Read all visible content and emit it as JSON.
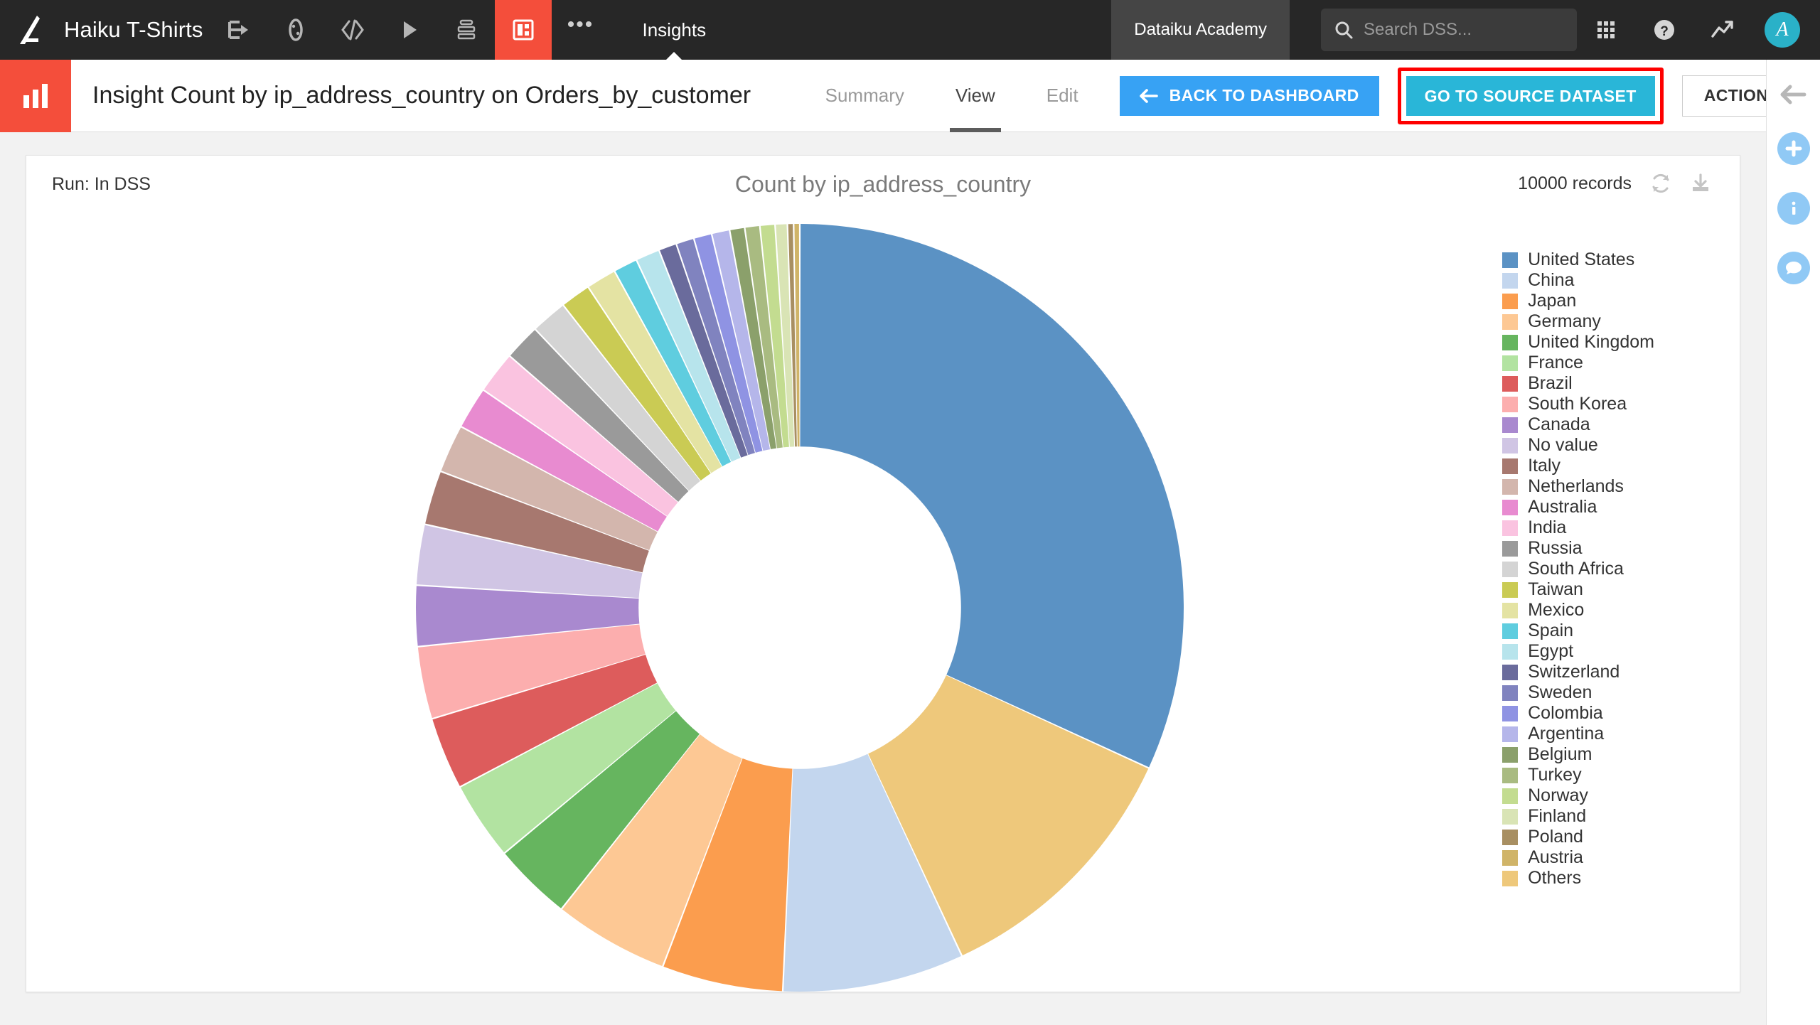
{
  "topbar": {
    "logo_icon": "dataiku-logo-icon",
    "project_name": "Haiku T-Shirts",
    "nav_icons": [
      {
        "name": "flow-icon",
        "label": "Flow"
      },
      {
        "name": "lab-icon",
        "label": "Lab"
      },
      {
        "name": "code-icon",
        "label": "Code"
      },
      {
        "name": "automation-icon",
        "label": "Automation"
      },
      {
        "name": "jobs-icon",
        "label": "Jobs"
      },
      {
        "name": "dashboards-icon",
        "label": "Dashboards"
      }
    ],
    "more_label": "•••",
    "current_section": "Insights",
    "academy_label": "Dataiku Academy",
    "search_placeholder": "Search DSS...",
    "search_value": "",
    "apps_icon": "apps-grid-icon",
    "help_icon": "help-circle-icon",
    "activity_icon": "trending-up-icon",
    "avatar_initial": "A",
    "accent_red": "#f44e3b",
    "avatar_color": "#2ab1c8"
  },
  "subbar": {
    "insight_icon": "bar-chart-icon",
    "title": "Insight Count by ip_address_country on Orders_by_customer",
    "tabs": [
      {
        "label": "Summary",
        "active": false
      },
      {
        "label": "View",
        "active": true
      },
      {
        "label": "Edit",
        "active": false
      }
    ],
    "back_to_dashboard_label": "BACK TO DASHBOARD",
    "back_arrow_icon": "arrow-left-icon",
    "go_to_source_label": "GO TO SOURCE DATASET",
    "actions_label": "ACTIONS",
    "highlight_color": "#fe0000",
    "primary_button_color": "#37a2f4",
    "source_button_color": "#29b6d8"
  },
  "right_rail": {
    "items": [
      {
        "name": "collapse-panel-icon",
        "glyph": "arrow-left"
      },
      {
        "name": "add-icon",
        "glyph": "plus"
      },
      {
        "name": "info-icon",
        "glyph": "info"
      },
      {
        "name": "discussions-icon",
        "glyph": "chat"
      }
    ],
    "circle_color": "#90c9f5"
  },
  "card": {
    "run_label": "Run: In DSS",
    "records_label": "10000 records",
    "refresh_icon": "refresh-icon",
    "download_icon": "download-icon"
  },
  "chart_data": {
    "type": "pie",
    "variant": "donut",
    "title": "Count by ip_address_country",
    "xlabel": "",
    "ylabel": "",
    "total_records": 10000,
    "legend_position": "right",
    "start_angle_deg": 0,
    "inner_radius_ratio": 0.42,
    "categories": [
      "United States",
      "China",
      "Japan",
      "Germany",
      "United Kingdom",
      "France",
      "Brazil",
      "South Korea",
      "Canada",
      "No value",
      "Italy",
      "Netherlands",
      "Australia",
      "India",
      "Russia",
      "South Africa",
      "Taiwan",
      "Mexico",
      "Spain",
      "Egypt",
      "Switzerland",
      "Sweden",
      "Colombia",
      "Argentina",
      "Belgium",
      "Turkey",
      "Norway",
      "Finland",
      "Poland",
      "Austria",
      "Others"
    ],
    "values": [
      3472,
      833,
      556,
      528,
      361,
      361,
      333,
      333,
      278,
      278,
      250,
      222,
      194,
      194,
      167,
      167,
      139,
      139,
      111,
      111,
      83,
      83,
      83,
      83,
      69,
      69,
      69,
      56,
      28,
      28,
      1222
    ],
    "colors": [
      "#5c93c6",
      "#c5d7ef",
      "#fc9e4f",
      "#fdc894",
      "#65b濃"
    ],
    "slice_colors": [
      "#5b92c4",
      "#c3d6ee",
      "#fb9d4e",
      "#fdc894",
      "#66b55f",
      "#b2e3a1",
      "#dd5c5c",
      "#fcaeae",
      "#a989cf",
      "#d0c5e4",
      "#a7786f",
      "#d3b6ad",
      "#e88bd0",
      "#fac3e0",
      "#9a9a9a",
      "#d4d4d4",
      "#cacb54",
      "#e4e3a3",
      "#5fcddf",
      "#b7e4ec",
      "#6a6b9c",
      "#8083bf",
      "#8f93e3",
      "#b5b6ea",
      "#8ba06b",
      "#a9bb81",
      "#c3dc90",
      "#d9e4b5",
      "#a88f62",
      "#d0b468",
      "#eec87b"
    ]
  },
  "legend": {
    "entries": [
      {
        "label": "United States",
        "color": "#5b92c4"
      },
      {
        "label": "China",
        "color": "#c3d6ee"
      },
      {
        "label": "Japan",
        "color": "#fb9d4e"
      },
      {
        "label": "Germany",
        "color": "#fdc894"
      },
      {
        "label": "United Kingdom",
        "color": "#66b55f"
      },
      {
        "label": "France",
        "color": "#b2e3a1"
      },
      {
        "label": "Brazil",
        "color": "#dd5c5c"
      },
      {
        "label": "South Korea",
        "color": "#fcaeae"
      },
      {
        "label": "Canada",
        "color": "#a989cf"
      },
      {
        "label": "No value",
        "color": "#d0c5e4"
      },
      {
        "label": "Italy",
        "color": "#a7786f"
      },
      {
        "label": "Netherlands",
        "color": "#d3b6ad"
      },
      {
        "label": "Australia",
        "color": "#e88bd0"
      },
      {
        "label": "India",
        "color": "#fac3e0"
      },
      {
        "label": "Russia",
        "color": "#9a9a9a"
      },
      {
        "label": "South Africa",
        "color": "#d4d4d4"
      },
      {
        "label": "Taiwan",
        "color": "#cacb54"
      },
      {
        "label": "Mexico",
        "color": "#e4e3a3"
      },
      {
        "label": "Spain",
        "color": "#5fcddf"
      },
      {
        "label": "Egypt",
        "color": "#b7e4ec"
      },
      {
        "label": "Switzerland",
        "color": "#6a6b9c"
      },
      {
        "label": "Sweden",
        "color": "#8083bf"
      },
      {
        "label": "Colombia",
        "color": "#8f93e3"
      },
      {
        "label": "Argentina",
        "color": "#b5b6ea"
      },
      {
        "label": "Belgium",
        "color": "#8ba06b"
      },
      {
        "label": "Turkey",
        "color": "#a9bb81"
      },
      {
        "label": "Norway",
        "color": "#c3dc90"
      },
      {
        "label": "Finland",
        "color": "#d9e4b5"
      },
      {
        "label": "Poland",
        "color": "#a88f62"
      },
      {
        "label": "Austria",
        "color": "#d0b468"
      },
      {
        "label": "Others",
        "color": "#eec87b"
      }
    ]
  }
}
